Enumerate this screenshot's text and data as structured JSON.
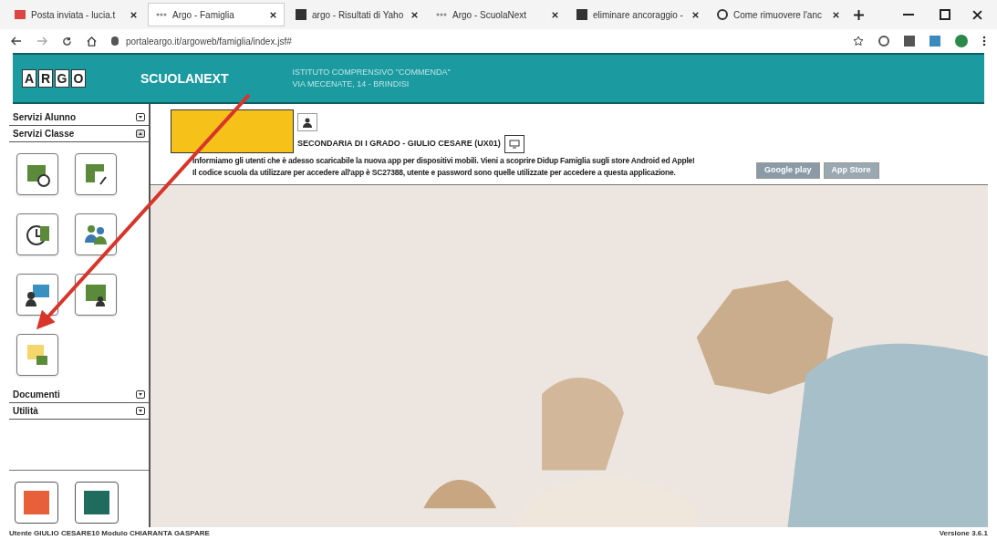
{
  "browser": {
    "tabs": [
      {
        "title": "Posta inviata - lucia.t",
        "selected": false
      },
      {
        "title": "Argo - Famiglia",
        "selected": true
      },
      {
        "title": "argo - Risultati di Yaho",
        "selected": false
      },
      {
        "title": "Argo - ScuolaNext",
        "selected": false
      },
      {
        "title": "eliminare ancoraggio -",
        "selected": false
      },
      {
        "title": "Come rimuovere l'anc",
        "selected": false
      }
    ],
    "url": "portaleargo.it/argoweb/famiglia/index.jsf#"
  },
  "header": {
    "logo_letters": [
      "A",
      "R",
      "G",
      "O"
    ],
    "product": "SCUOLANEXT",
    "school": "ISTITUTO COMPRENSIVO \"COMMENDA\"",
    "address": "VIA MECENATE, 14 - BRINDISI"
  },
  "sidebar": {
    "sections": [
      {
        "title": "Servizi Alunno",
        "expanded": false
      },
      {
        "title": "Servizi Classe",
        "expanded": true
      },
      {
        "title": "Documenti",
        "expanded": false
      },
      {
        "title": "Utilità",
        "expanded": false
      }
    ],
    "bottom_tiles": [
      {
        "color": "#e8603a"
      },
      {
        "color": "#1f6b5e"
      }
    ]
  },
  "main": {
    "school_unit": "SECONDARIA DI I GRADO - GIULIO CESARE (UX01)",
    "notice_lines": [
      "Informiamo gli utenti che è adesso scaricabile la nuova app per dispositivi mobili. Vieni a scoprire Didup Famiglia sugli store Android ed Apple!",
      "Il codice scuola da utilizzare per accedere all'app è SC27388, utente e password sono quelle utilizzate per accedere a questa applicazione."
    ],
    "stores": [
      "Google play",
      "App Store"
    ]
  },
  "status_bar": {
    "user": "Utente GIULIO CESARE10 Modulo CHIARANTA GASPARE",
    "version": "Versione 3.6.1"
  }
}
